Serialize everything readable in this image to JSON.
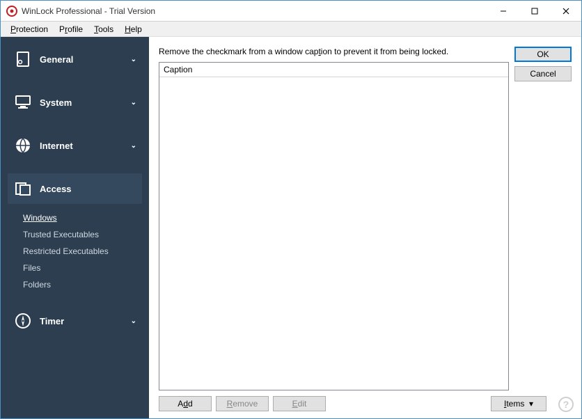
{
  "window": {
    "title": "WinLock Professional - Trial Version"
  },
  "menu": {
    "items": [
      "Protection",
      "Profile",
      "Tools",
      "Help"
    ],
    "hotkeys": [
      "P",
      "r",
      "T",
      "H"
    ]
  },
  "sidebar": {
    "categories": [
      {
        "id": "general",
        "label": "General",
        "expanded": false
      },
      {
        "id": "system",
        "label": "System",
        "expanded": false
      },
      {
        "id": "internet",
        "label": "Internet",
        "expanded": false
      },
      {
        "id": "access",
        "label": "Access",
        "expanded": true,
        "items": [
          {
            "id": "windows",
            "label": "Windows",
            "selected": true
          },
          {
            "id": "trusted-exe",
            "label": "Trusted Executables",
            "selected": false
          },
          {
            "id": "restricted-exe",
            "label": "Restricted Executables",
            "selected": false
          },
          {
            "id": "files",
            "label": "Files",
            "selected": false
          },
          {
            "id": "folders",
            "label": "Folders",
            "selected": false
          }
        ]
      },
      {
        "id": "timer",
        "label": "Timer",
        "expanded": false
      }
    ]
  },
  "main": {
    "instruction": "Remove the checkmark from a window caption to prevent it from being locked.",
    "list_header": "Caption"
  },
  "buttons": {
    "ok": "OK",
    "cancel": "Cancel",
    "add": "Add",
    "remove": "Remove",
    "edit": "Edit",
    "items": "Items"
  }
}
